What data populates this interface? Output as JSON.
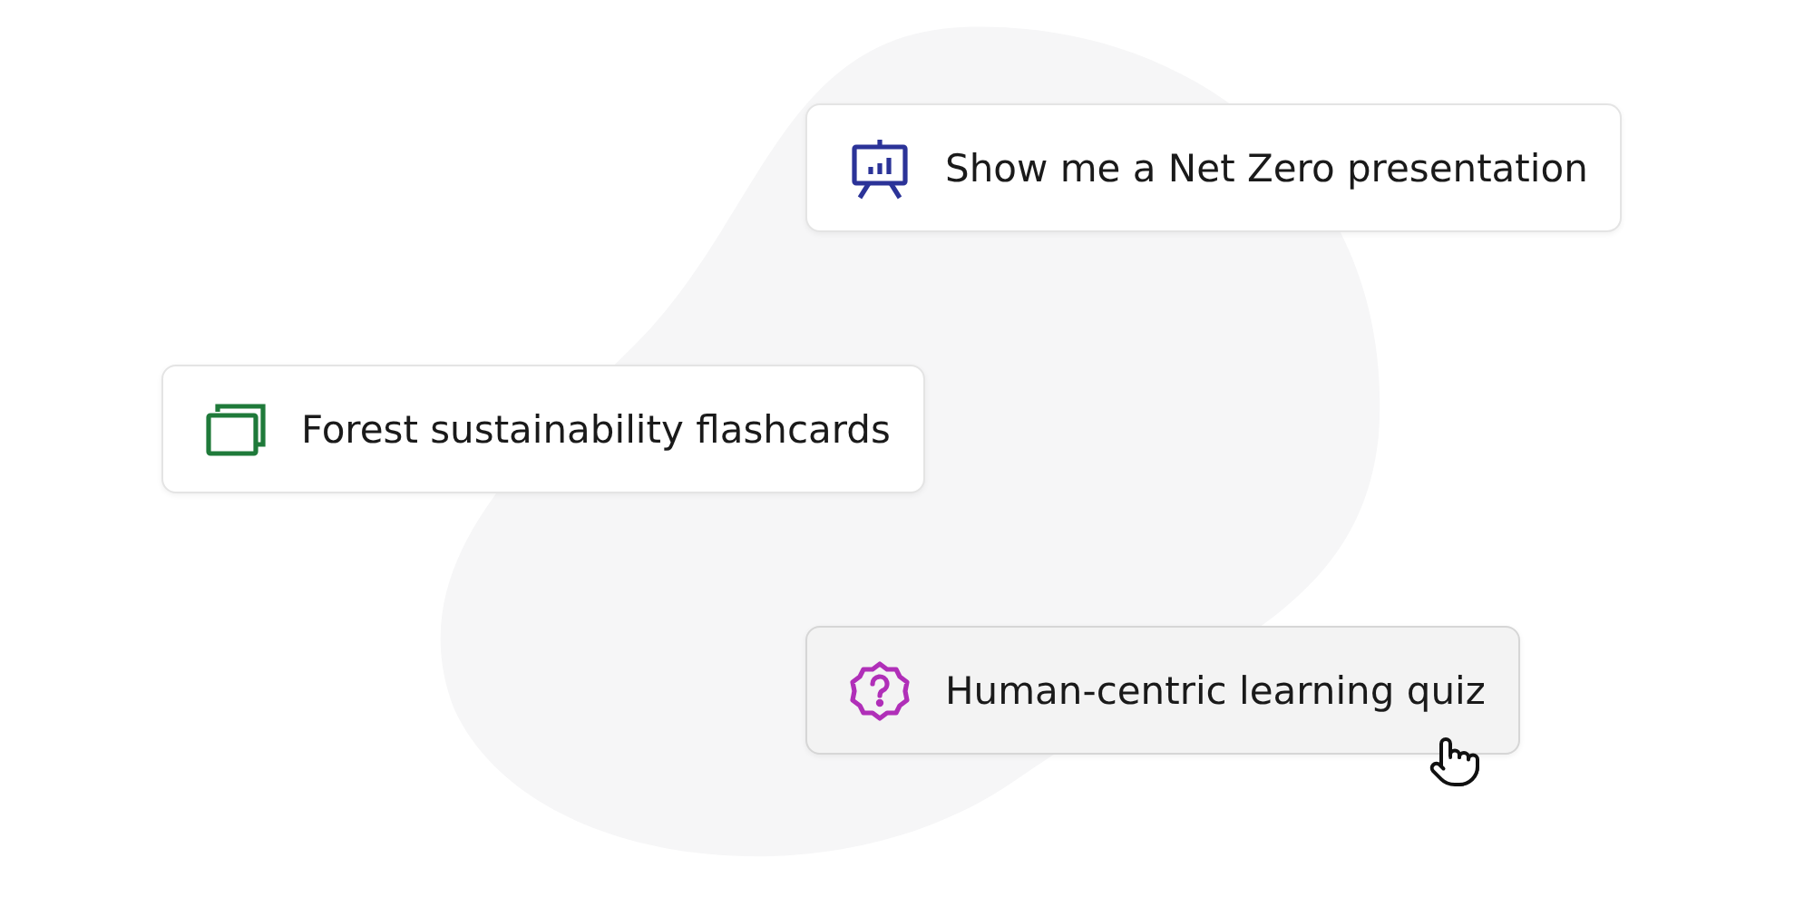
{
  "suggestions": [
    {
      "kind": "presentation",
      "label": "Show me a Net Zero presentation",
      "color": "#2b3398",
      "hovered": false
    },
    {
      "kind": "flashcards",
      "label": "Forest sustainability flashcards",
      "color": "#1f7a3a",
      "hovered": false
    },
    {
      "kind": "quiz",
      "label": "Human-centric learning quiz",
      "color": "#b02fb8",
      "hovered": true
    }
  ]
}
